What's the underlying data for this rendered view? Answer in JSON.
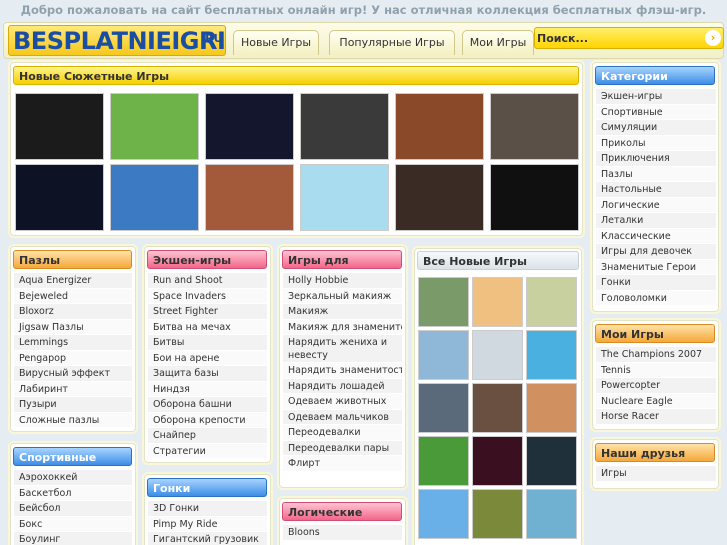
{
  "welcome": "Добро пожаловать на сайт бесплатных онлайн игр! У нас отличная коллекция бесплатных флэш-игр.",
  "logo": {
    "text": "BESPLATNIEIGRI",
    "suffix": ".RU"
  },
  "tabs": [
    "Новые Игры",
    "Популярные Игры",
    "Мои Игры"
  ],
  "search": {
    "placeholder": "Поиск...",
    "button_icon": "chevron-right-icon"
  },
  "featured": {
    "title": "Новые Сюжетные Игры",
    "thumbs": [
      {
        "bg": "#1b1b1b"
      },
      {
        "bg": "#6db34a"
      },
      {
        "bg": "#14162e"
      },
      {
        "bg": "#3a3a3a"
      },
      {
        "bg": "#8a4a2a"
      },
      {
        "bg": "#5a5048"
      },
      {
        "bg": "#0d1324"
      },
      {
        "bg": "#3c7bc4"
      },
      {
        "bg": "#a35a3a"
      },
      {
        "bg": "#a9dcef"
      },
      {
        "bg": "#3a2c24"
      },
      {
        "bg": "#101010"
      }
    ]
  },
  "puzzles": {
    "title": "Пазлы",
    "items": [
      "Aqua Energizer",
      "Bejeweled",
      "Bloxorz",
      "Jigsaw Пазлы",
      "Lemmings",
      "Pengapop",
      "Вирусный эффект",
      "Лабиринт",
      "Пузыри",
      "Сложные пазлы"
    ]
  },
  "sport": {
    "title": "Спортивные",
    "items": [
      "Аэрохоккей",
      "Баскетбол",
      "Бейсбол",
      "Бокс",
      "Боулинг"
    ]
  },
  "action": {
    "title": "Экшен-игры",
    "items": [
      "Run and Shoot",
      "Space Invaders",
      "Street Fighter",
      "Битва на мечах",
      "Битвы",
      "Бои на арене",
      "Защита базы",
      "Ниндзя",
      "Оборона башни",
      "Оборона крепости",
      "Снайпер",
      "Стратегии"
    ]
  },
  "racing": {
    "title": "Гонки",
    "items": [
      "3D Гонки",
      "Pimp My Ride",
      "Гигантский грузовик"
    ]
  },
  "girls": {
    "title": "Игры для девочек",
    "items": [
      "Holly Hobbie",
      "Зеркальный макияж",
      "Макияж",
      "Макияж для знаменитост",
      "Нарядить жениха и невесту",
      "Нарядить знаменитость",
      "Нарядить лошадей",
      "Одеваем животных",
      "Одеваем мальчиков",
      "Переодевалки",
      "Переодевалки пары",
      "Флирт"
    ]
  },
  "logic": {
    "title": "Логические",
    "items": [
      "Bloons"
    ]
  },
  "new_games": {
    "title": "Все Новые Игры",
    "thumbs": [
      {
        "bg": "#7a9a6a"
      },
      {
        "bg": "#f0c080"
      },
      {
        "bg": "#c8d0a0"
      },
      {
        "bg": "#8fb8d8"
      },
      {
        "bg": "#d0d8e0"
      },
      {
        "bg": "#4ab0e0"
      },
      {
        "bg": "#5a6a7a"
      },
      {
        "bg": "#6a5040"
      },
      {
        "bg": "#d09060"
      },
      {
        "bg": "#4a9a3a"
      },
      {
        "bg": "#3a1020"
      },
      {
        "bg": "#20303a"
      },
      {
        "bg": "#6ab0e8"
      },
      {
        "bg": "#7a8a3a"
      },
      {
        "bg": "#70b0d0"
      }
    ]
  },
  "categories": {
    "title": "Категории",
    "items": [
      "Экшен-игры",
      "Спортивные",
      "Симуляции",
      "Приколы",
      "Приключения",
      "Пазлы",
      "Настольные",
      "Логические",
      "Леталки",
      "Классические",
      "Игры для девочек",
      "Знаменитые Герои",
      "Гонки",
      "Головоломки"
    ]
  },
  "my_games": {
    "title": "Мои Игры",
    "items": [
      "The Champions 2007",
      "Tennis",
      "Powercopter",
      "Nucleare Eagle",
      "Horse Racer"
    ]
  },
  "friends": {
    "title": "Наши друзья",
    "items": [
      "Игры"
    ]
  }
}
